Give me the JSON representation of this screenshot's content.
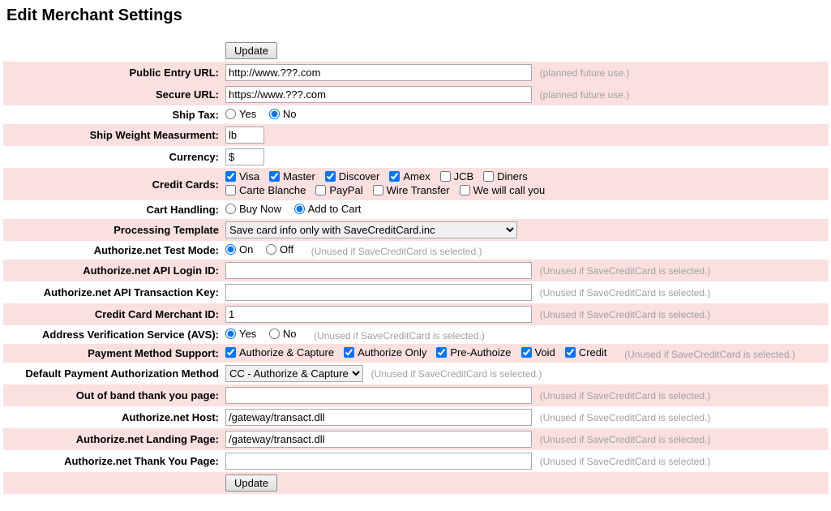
{
  "title": "Edit Merchant Settings",
  "update_label": "Update",
  "hints": {
    "future": "(planned future use.)",
    "unused": "(Unused if SaveCreditCard is selected.)"
  },
  "rows": {
    "public_url": {
      "label": "Public Entry URL:",
      "value": "http://www.???.com"
    },
    "secure_url": {
      "label": "Secure URL:",
      "value": "https://www.???.com"
    },
    "ship_tax": {
      "label": "Ship Tax:",
      "yes": "Yes",
      "no": "No",
      "selected": "no"
    },
    "ship_wt": {
      "label": "Ship Weight Measurment:",
      "value": "lb"
    },
    "currency": {
      "label": "Currency:",
      "value": "$"
    },
    "credit_cards": {
      "label": "Credit Cards:",
      "row1": [
        {
          "name": "Visa",
          "checked": true
        },
        {
          "name": "Master",
          "checked": true
        },
        {
          "name": "Discover",
          "checked": true
        },
        {
          "name": "Amex",
          "checked": true
        },
        {
          "name": "JCB",
          "checked": false
        },
        {
          "name": "Diners",
          "checked": false
        }
      ],
      "row2": [
        {
          "name": "Carte Blanche",
          "checked": false
        },
        {
          "name": "PayPal",
          "checked": false
        },
        {
          "name": "Wire Transfer",
          "checked": false
        },
        {
          "name": "We will call you",
          "checked": false
        }
      ]
    },
    "cart": {
      "label": "Cart Handling:",
      "buy": "Buy Now",
      "add": "Add to Cart",
      "selected": "add"
    },
    "template": {
      "label": "Processing Template",
      "value": "Save card info only with SaveCreditCard.inc"
    },
    "test_mode": {
      "label": "Authorize.net Test Mode:",
      "on": "On",
      "off": "Off",
      "selected": "on"
    },
    "api_login": {
      "label": "Authorize.net API Login ID:",
      "value": ""
    },
    "api_key": {
      "label": "Authorize.net API Transaction Key:",
      "value": ""
    },
    "merchant_id": {
      "label": "Credit Card Merchant ID:",
      "value": "1"
    },
    "avs": {
      "label": "Address Verification Service (AVS):",
      "yes": "Yes",
      "no": "No",
      "selected": "yes"
    },
    "pay_support": {
      "label": "Payment Method Support:",
      "opts": [
        {
          "name": "Authorize & Capture",
          "checked": true
        },
        {
          "name": "Authorize Only",
          "checked": true
        },
        {
          "name": "Pre-Authoize",
          "checked": true
        },
        {
          "name": "Void",
          "checked": true
        },
        {
          "name": "Credit",
          "checked": true
        }
      ]
    },
    "default_auth": {
      "label": "Default Payment Authorization Method",
      "value": "CC - Authorize & Capture"
    },
    "oob_thanks": {
      "label": "Out of band thank you page:",
      "value": ""
    },
    "anet_host": {
      "label": "Authorize.net Host:",
      "value": "/gateway/transact.dll"
    },
    "anet_landing": {
      "label": "Authorize.net Landing Page:",
      "value": "/gateway/transact.dll"
    },
    "anet_thanks": {
      "label": "Authorize.net Thank You Page:",
      "value": ""
    }
  }
}
